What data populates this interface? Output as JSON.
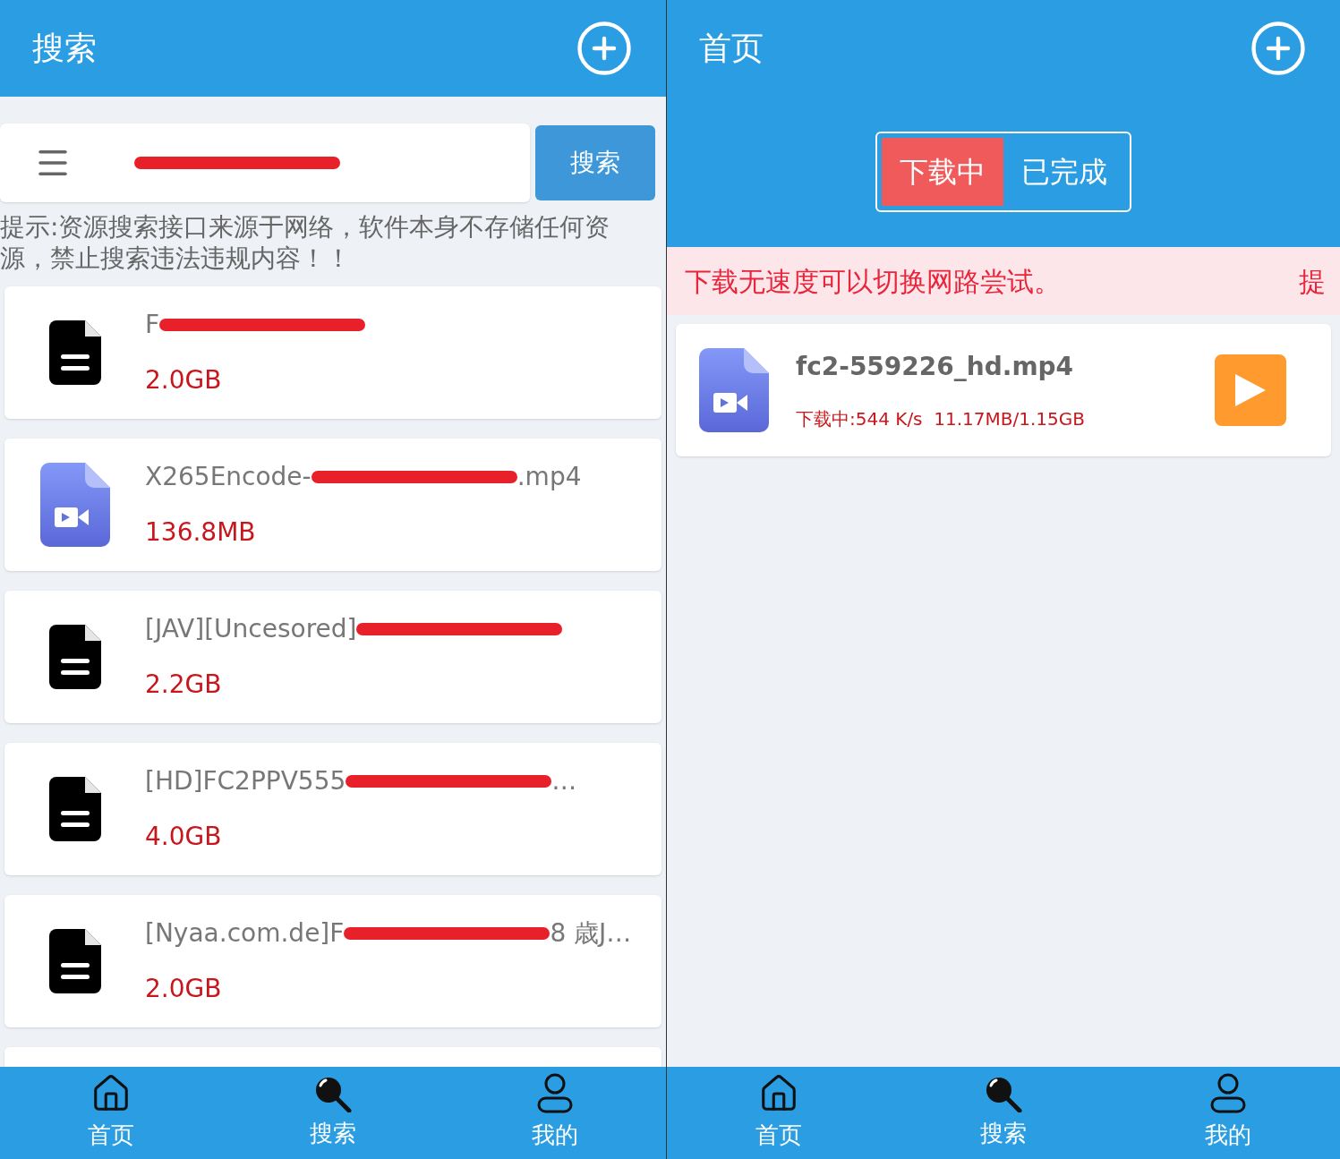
{
  "search_screen": {
    "title": "搜索",
    "search_field": {
      "value_parts": [
        {
          "kind": "redaction"
        }
      ]
    },
    "search_button": "搜索",
    "hint": "提示:资源搜索接口来源于网络，软件本身不存储任何资源，禁止搜索违法违规内容！！",
    "results": [
      {
        "kind": "doc",
        "title_parts": [
          {
            "kind": "text",
            "text": "F"
          },
          {
            "kind": "redaction"
          }
        ],
        "size": "2.0GB"
      },
      {
        "kind": "video",
        "title_parts": [
          {
            "kind": "text",
            "text": "X265Encode-"
          },
          {
            "kind": "redaction"
          },
          {
            "kind": "text",
            "text": ".mp4"
          }
        ],
        "size": "136.8MB"
      },
      {
        "kind": "doc",
        "title_parts": [
          {
            "kind": "text",
            "text": "[JAV][Uncesored]"
          },
          {
            "kind": "redaction"
          }
        ],
        "size": "2.2GB"
      },
      {
        "kind": "doc",
        "title_parts": [
          {
            "kind": "text",
            "text": "[HD]FC2PPV555"
          },
          {
            "kind": "redaction"
          },
          {
            "kind": "text",
            "text": "…"
          }
        ],
        "size": "4.0GB"
      },
      {
        "kind": "doc",
        "title_parts": [
          {
            "kind": "text",
            "text": "[Nyaa.com.de]F"
          },
          {
            "kind": "redaction"
          },
          {
            "kind": "text",
            "text": "8 歳J…"
          }
        ],
        "size": "2.0GB"
      }
    ],
    "nav": [
      {
        "kind": "home",
        "label": "首页"
      },
      {
        "kind": "search",
        "label": "搜索"
      },
      {
        "kind": "user",
        "label": "我的"
      }
    ]
  },
  "home_screen": {
    "title": "首页",
    "tabs": [
      {
        "label": "下载中",
        "selected": true
      },
      {
        "label": "已完成",
        "selected": false
      }
    ],
    "notice": [
      "下载无速度可以切换网路尝试。",
      "提"
    ],
    "downloads": [
      {
        "kind": "video",
        "name": "fc2-559226_hd.mp4",
        "status": "下载中:544 K/s  11.17MB/1.15GB"
      }
    ],
    "nav": [
      {
        "kind": "home",
        "label": "首页"
      },
      {
        "kind": "search",
        "label": "搜索"
      },
      {
        "kind": "user",
        "label": "我的"
      }
    ]
  }
}
